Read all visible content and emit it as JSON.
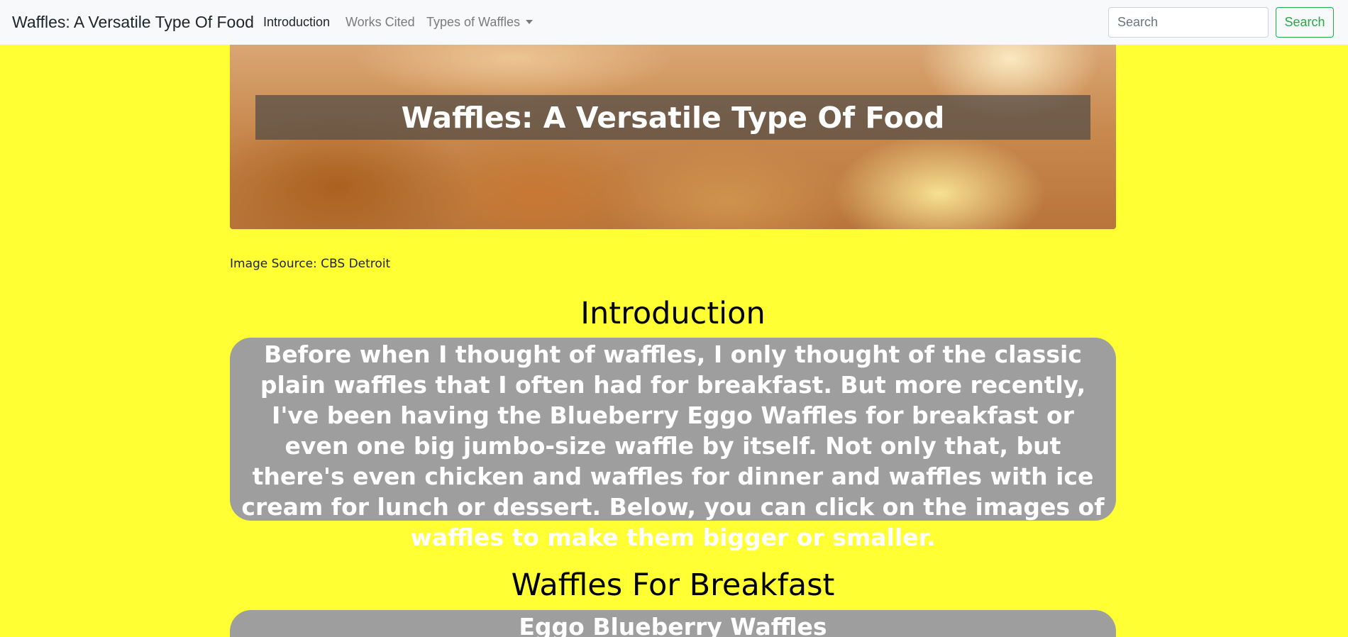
{
  "navbar": {
    "brand": "Waffles: A Versatile Type Of Food",
    "links": [
      {
        "label": "Introduction",
        "active": true
      },
      {
        "label": "Works Cited",
        "active": false
      },
      {
        "label": "Types of Waffles",
        "active": false
      }
    ],
    "search_placeholder": "Search",
    "search_button": "Search"
  },
  "hero": {
    "title": "Waffles: A Versatile Type Of Food"
  },
  "image_source": "Image Source: CBS Detroit",
  "intro": {
    "heading": "Introduction",
    "text": "Before when I thought of waffles, I only thought of the classic plain waffles that I often had for breakfast. But more recently, I've been having the Blueberry Eggo Waffles for breakfast or even one big jumbo-size waffle by itself. Not only that, but there's even chicken and waffles for dinner and waffles with ice cream for lunch or dessert. Below, you can click on the images of waffles to make them bigger or smaller."
  },
  "breakfast": {
    "heading": "Waffles For Breakfast",
    "subheading": "Eggo Blueberry Waffles"
  },
  "colors": {
    "page_background": "#ffff33",
    "navbar_background": "#f8f9fa",
    "text_box_background": "#9e9e9e",
    "search_button": "#28a745"
  }
}
